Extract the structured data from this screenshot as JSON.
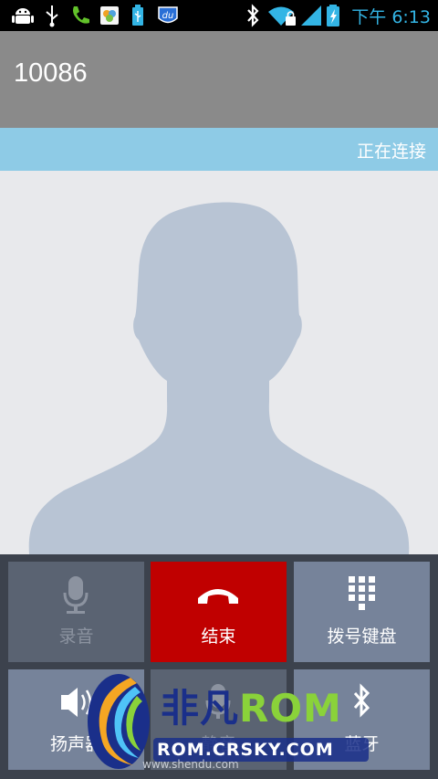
{
  "status_bar": {
    "time": "下午 6:13",
    "icons": [
      "android-icon",
      "usb-icon",
      "call-icon",
      "photos-icon",
      "usb-storage-icon",
      "baidu-du-icon",
      "bluetooth-icon",
      "wifi-icon",
      "signal-icon",
      "battery-charging-icon"
    ]
  },
  "call": {
    "number": "10086",
    "state": "正在连接"
  },
  "buttons": {
    "record": "录音",
    "end": "结束",
    "keypad": "拨号键盘",
    "speaker": "扬声器",
    "mute": "静音",
    "bluetooth": "蓝牙"
  },
  "watermark": {
    "title_cn": "非凡",
    "title_rom": "ROM",
    "url": "ROM.CRSKY.COM",
    "small": "www.shendu.com"
  },
  "colors": {
    "status_time": "#33b5e5",
    "header": "#8a8a8a",
    "state_bar": "#8ecbe6",
    "end_button": "#c00000",
    "button_active": "#76839a",
    "button_disabled": "#5a6372"
  }
}
